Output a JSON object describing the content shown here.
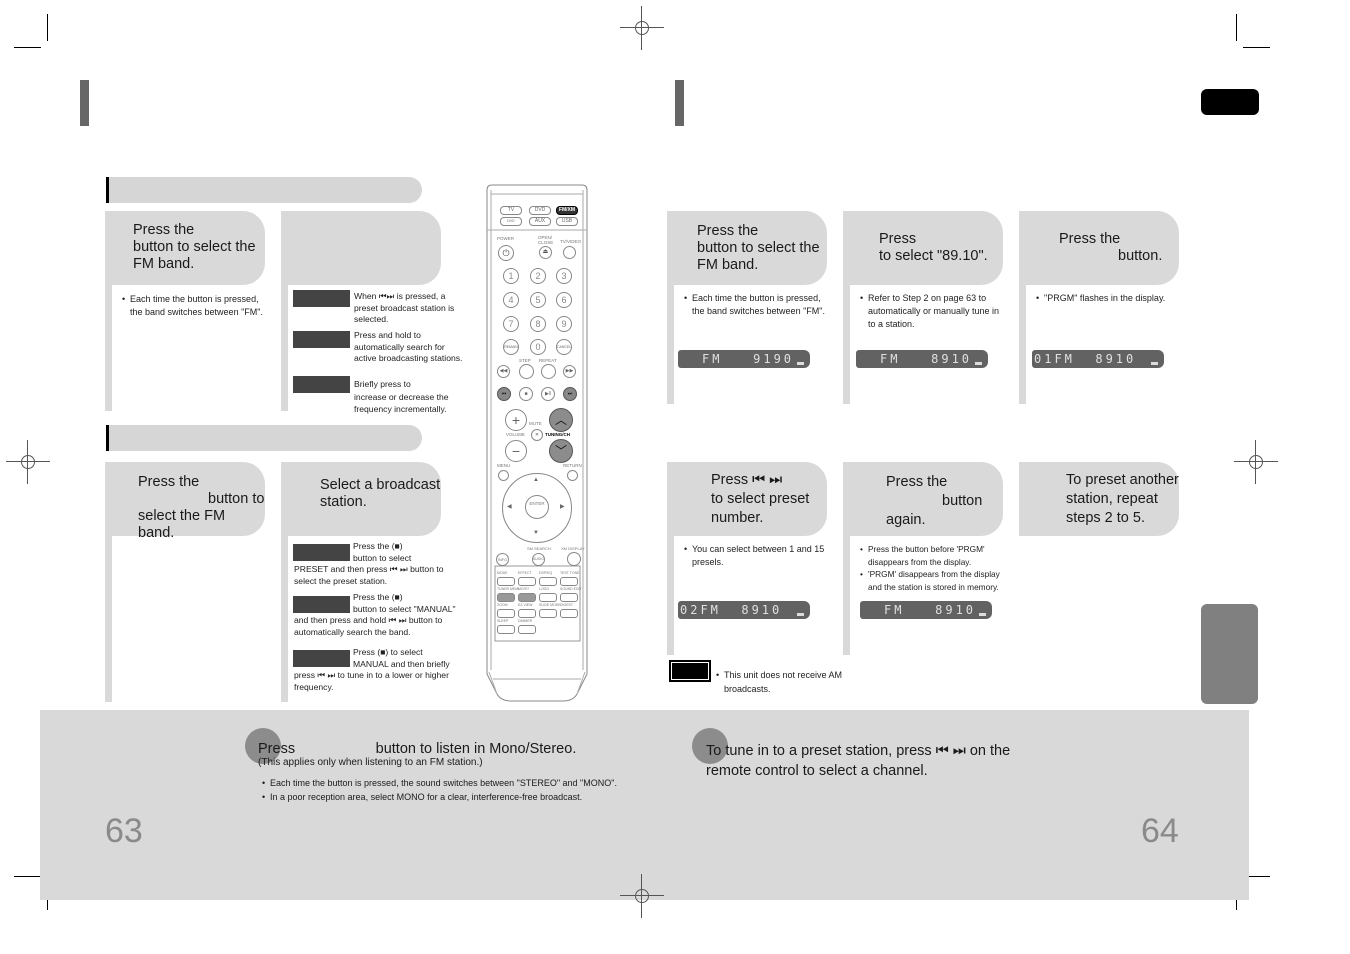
{
  "page_left": {
    "number": "63",
    "section1": {
      "step1": {
        "heading_lines": [
          "Press the",
          "button to select the",
          "FM band."
        ],
        "bullet": "Each time the button is pressed, the band switches between \"FM\"."
      },
      "step2": {
        "notes": [
          {
            "line1": "When ⏮⏭ is pressed, a",
            "rest": "preset broadcast station is selected."
          },
          {
            "line1": "Press and hold                        to",
            "rest": "automatically search for active broadcasting stations."
          },
          {
            "line1": "Briefly press                          to",
            "rest": "increase or decrease the frequency incrementally."
          }
        ]
      }
    },
    "section2": {
      "step1": {
        "heading_lines": [
          "Press the",
          "button to",
          "select the FM band."
        ]
      },
      "step2": {
        "heading_lines": [
          "Select a broadcast",
          "station."
        ],
        "notes": [
          {
            "line1": "Press the            (■)",
            "line2": "button to select",
            "rest": "PRESET and then press ⏮ ⏭ button to select the preset station."
          },
          {
            "line1": "Press the            (■)",
            "line2": "button to select \"MANUAL\"",
            "rest": "and then press and hold ⏮ ⏭ button to automatically search the band."
          },
          {
            "line1": "Press            (■) to select",
            "line2": "MANUAL and then briefly",
            "rest": "press ⏮ ⏭ to tune in to a lower or higher frequency."
          }
        ]
      }
    },
    "bottom": {
      "heading": "Press                    button to listen in Mono/Stereo.",
      "subheading": "(This applies only when listening to an FM station.)",
      "bullets": [
        "Each time the button is pressed, the sound switches between \"STEREO\" and \"MONO\".",
        "In a poor reception area, select MONO for a clear, interference-free broadcast."
      ]
    }
  },
  "remote": {
    "source_buttons": [
      "TV",
      "DVD",
      "FM/XM",
      "DVD RECEIVER",
      "AUX",
      "USB"
    ],
    "labels": {
      "power": "POWER",
      "open_close": "OPEN/ CLOSE",
      "tv_video": "TV/VIDEO",
      "step": "STEP",
      "repeat": "REPEAT",
      "mute": "MUTE",
      "volume": "VOLUME",
      "tuning": "TUNING/CH",
      "menu": "MENU",
      "return": "RETURN",
      "enter": "ENTER",
      "info": "INFO",
      "sm_search": "SM SEARCH",
      "xm_display": "XM DISPLAY",
      "mode": "MODE",
      "effect": "EFFECT",
      "dimmer_top": "DSP/EQ",
      "test_tone": "TEST TONE",
      "tuner_memory": "TUNER MEMORY",
      "slow": "SLOW",
      "logo": "LOGO",
      "sound_edit": "SOUND EDIT",
      "mo_st": "MO/ST",
      "zoom": "ZOOM",
      "ez_view": "EZ VIEW",
      "slide_mode": "SLIDE MODE",
      "digest": "DIGEST",
      "sleep": "SLEEP",
      "dimmer": "DIMMER",
      "remain": "REMAIN",
      "cancel": "CANCEL",
      "audio": "AUDIO"
    },
    "digits": [
      "1",
      "2",
      "3",
      "4",
      "5",
      "6",
      "7",
      "8",
      "9",
      "0"
    ]
  },
  "page_right": {
    "number": "64",
    "steps": [
      {
        "heading_lines": [
          "Press the",
          "button to select the",
          "FM band."
        ],
        "bullets": [
          "Each time the button is pressed, the band switches between \"FM\"."
        ],
        "display": "FM   9190"
      },
      {
        "heading_lines": [
          "Press",
          "to select \"89.10\"."
        ],
        "bullets": [
          "Refer to Step 2 on page 63 to automatically or manually tune in to a station."
        ],
        "display": "FM   8910"
      },
      {
        "heading_lines": [
          "Press the",
          "button."
        ],
        "bullets": [
          "\"PRGM\" flashes in the display."
        ],
        "display": "01FM  8910"
      },
      {
        "heading_lines": [
          "Press ⏮ ⏭",
          "to select preset",
          "number."
        ],
        "bullets": [
          "You can select between 1 and 15 presels."
        ],
        "display": "02FM  8910"
      },
      {
        "heading_lines": [
          "Press the",
          "button",
          "again."
        ],
        "bullets": [
          "Press the                                   button before 'PRGM' disappears from the display.",
          "'PRGM' disappears from the display and the station is stored in memory."
        ],
        "display": "FM   8910"
      },
      {
        "heading_lines": [
          "To preset another",
          "station, repeat",
          "steps 2 to 5."
        ]
      }
    ],
    "note": "This unit does not receive AM broadcasts.",
    "bottom": {
      "line1": "To tune in to a preset station, press ⏮ ⏭  on the",
      "line2": "remote control to select a channel."
    }
  },
  "colors": {
    "panel_gray": "#d9d9d9",
    "title_bar": "#666666",
    "lcd": "#626262",
    "tab_dark": "#000000",
    "side_tab": "#808080",
    "page_number": "#8a8a8a"
  }
}
